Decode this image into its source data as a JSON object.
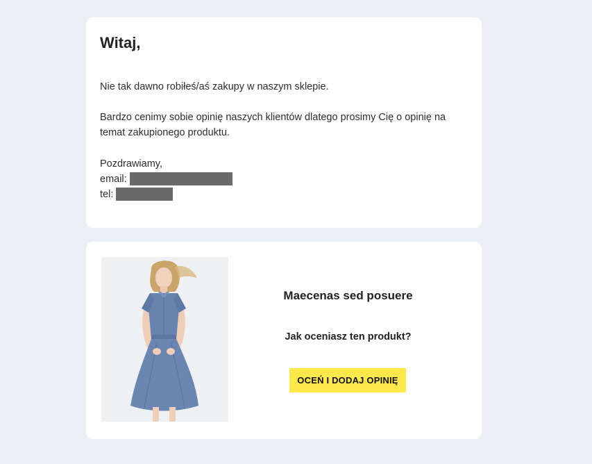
{
  "message": {
    "greeting": "Witaj,",
    "paragraph_1": "Nie tak dawno robiłeś/aś zakupy w naszym sklepie.",
    "paragraph_2": "Bardzo cenimy sobie opinię naszych klientów dlatego prosimy Cię o opinię na temat zakupionego produktu.",
    "closing": "Pozdrawiamy,",
    "email_label": "email:",
    "tel_label": "tel:"
  },
  "product": {
    "name": "Maecenas sed posuere",
    "question": "Jak oceniasz ten produkt?",
    "button_label": "OCEŃ I DODAJ OPINIĘ",
    "button_color": "#ffe84a",
    "image_description_icon": "product-photo-dress"
  },
  "colors": {
    "page_background": "#ebeff4",
    "card_background": "#ffffff",
    "redaction": "#6a6a6a"
  }
}
